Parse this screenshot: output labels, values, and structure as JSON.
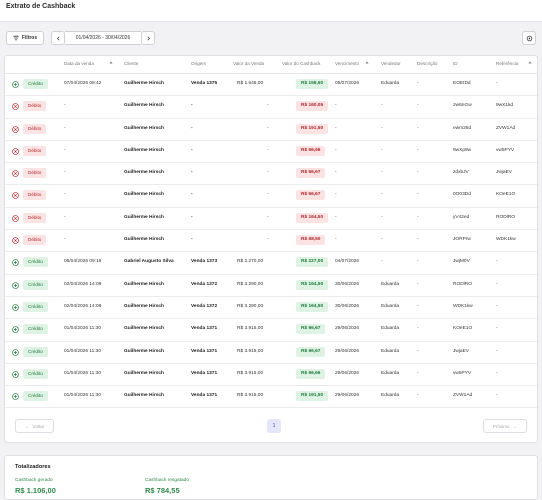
{
  "page": {
    "title": "Extrato de Cashback"
  },
  "toolbar": {
    "filters_label": "Filtros",
    "date_range": "01/04/2026 - 30/04/2026"
  },
  "table": {
    "headers": [
      "Data da venda",
      "Cliente",
      "Origem",
      "Valor da Venda",
      "Valor do Cashback",
      "Vencimento",
      "Vendedor",
      "Descrição",
      "ID",
      "Referência"
    ],
    "rows": [
      {
        "kind": "credit",
        "type": "Crédito",
        "date": "07/04/2026 08:42",
        "client": "Guilherme Hirsch",
        "origin": "Venda 1375",
        "sale": "R$ 1.645,00",
        "cashback": "R$ 158,50",
        "due": "05/07/2026",
        "seller": "Eduarda",
        "desc": "-",
        "id": "EOEIDd",
        "ref": "-"
      },
      {
        "kind": "debit",
        "type": "Débito",
        "date": "-",
        "client": "Guilherme Hirsch",
        "origin": "-",
        "sale": "-",
        "cashback": "R$ 160,05",
        "due": "-",
        "seller": "-",
        "desc": "-",
        "id": "2w6nGw",
        "ref": "9wX1kd"
      },
      {
        "kind": "debit",
        "type": "Débito",
        "date": "-",
        "client": "Guilherme Hirsch",
        "origin": "-",
        "sale": "-",
        "cashback": "R$ 191,50",
        "due": "-",
        "seller": "-",
        "desc": "-",
        "id": "ewm26d",
        "ref": "ZVW1Ad"
      },
      {
        "kind": "debit",
        "type": "Débito",
        "date": "-",
        "client": "Guilherme Hirsch",
        "origin": "-",
        "sale": "-",
        "cashback": "R$ 66,66",
        "due": "-",
        "seller": "-",
        "desc": "-",
        "id": "9wXp9w",
        "ref": "vw5PYV"
      },
      {
        "kind": "debit",
        "type": "Débito",
        "date": "-",
        "client": "Guilherme Hirsch",
        "origin": "-",
        "sale": "-",
        "cashback": "R$ 66,67",
        "due": "-",
        "seller": "-",
        "desc": "-",
        "id": "zdxbJV",
        "ref": "JwjaEV"
      },
      {
        "kind": "debit",
        "type": "Débito",
        "date": "-",
        "client": "Guilherme Hirsch",
        "origin": "-",
        "sale": "-",
        "cashback": "R$ 66,67",
        "due": "-",
        "seller": "-",
        "desc": "-",
        "id": "0O03Dd",
        "ref": "KOeE1O"
      },
      {
        "kind": "debit",
        "type": "Débito",
        "date": "-",
        "client": "Guilherme Hirsch",
        "origin": "-",
        "sale": "-",
        "cashback": "R$ 164,50",
        "due": "-",
        "seller": "-",
        "desc": "-",
        "id": "yV42ed",
        "ref": "RODlRO"
      },
      {
        "kind": "debit",
        "type": "Débito",
        "date": "-",
        "client": "Guilherme Hirsch",
        "origin": "-",
        "sale": "-",
        "cashback": "R$ 68,50",
        "due": "-",
        "seller": "-",
        "desc": "-",
        "id": "JORPrw",
        "ref": "WDK1kw"
      },
      {
        "kind": "credit",
        "type": "Crédito",
        "date": "06/04/2026 09:16",
        "client": "Gabriel Augusto Silva",
        "origin": "Venda 1373",
        "sale": "R$ 2.270,00",
        "cashback": "R$ 227,00",
        "due": "04/07/2026",
        "seller": "-",
        "desc": "-",
        "id": "JwjM0V",
        "ref": "-"
      },
      {
        "kind": "credit",
        "type": "Crédito",
        "date": "02/04/2026 14:08",
        "client": "Guilherme Hirsch",
        "origin": "Venda 1372",
        "sale": "R$ 3.290,00",
        "cashback": "R$ 164,50",
        "due": "30/06/2026",
        "seller": "Eduarda",
        "desc": "-",
        "id": "RODlRO",
        "ref": "-"
      },
      {
        "kind": "credit",
        "type": "Crédito",
        "date": "02/04/2026 14:08",
        "client": "Guilherme Hirsch",
        "origin": "Venda 1372",
        "sale": "R$ 3.290,00",
        "cashback": "R$ 164,50",
        "due": "30/06/2026",
        "seller": "Eduarda",
        "desc": "-",
        "id": "WDK1kw",
        "ref": "-"
      },
      {
        "kind": "credit",
        "type": "Crédito",
        "date": "01/04/2026 11:30",
        "client": "Guilherme Hirsch",
        "origin": "Venda 1371",
        "sale": "R$ 3.915,00",
        "cashback": "R$ 66,67",
        "due": "29/06/2026",
        "seller": "Eduarda",
        "desc": "-",
        "id": "KOeE1O",
        "ref": "-"
      },
      {
        "kind": "credit",
        "type": "Crédito",
        "date": "01/04/2026 11:30",
        "client": "Guilherme Hirsch",
        "origin": "Venda 1371",
        "sale": "R$ 3.915,00",
        "cashback": "R$ 66,67",
        "due": "29/06/2026",
        "seller": "Eduarda",
        "desc": "-",
        "id": "JwjaEV",
        "ref": "-"
      },
      {
        "kind": "credit",
        "type": "Crédito",
        "date": "01/04/2026 11:30",
        "client": "Guilherme Hirsch",
        "origin": "Venda 1371",
        "sale": "R$ 3.915,00",
        "cashback": "R$ 66,66",
        "due": "29/06/2026",
        "seller": "Eduarda",
        "desc": "-",
        "id": "vw5PYV",
        "ref": "-"
      },
      {
        "kind": "credit",
        "type": "Crédito",
        "date": "01/04/2026 11:30",
        "client": "Guilherme Hirsch",
        "origin": "Venda 1371",
        "sale": "R$ 3.915,00",
        "cashback": "R$ 191,50",
        "due": "29/06/2026",
        "seller": "Eduarda",
        "desc": "-",
        "id": "ZVW1Ad",
        "ref": "-"
      }
    ]
  },
  "pagination": {
    "prev_label": "Voltar",
    "page": "1",
    "next_label": "Próximo"
  },
  "totals": {
    "title": "Totalizadores",
    "generated_label": "Cashback gerado",
    "generated_value": "R$ 1.106,00",
    "redeemed_label": "Cashback resgatado",
    "redeemed_value": "R$ 784,55"
  },
  "colors": {
    "credit": "#1d7a3a",
    "debit": "#b3262b",
    "accent": "#4b4bc8"
  },
  "icons": [
    "filter-icon",
    "chevron-left-icon",
    "chevron-right-icon",
    "settings-icon",
    "credit-plus-icon",
    "debit-x-icon",
    "sort-icon"
  ]
}
